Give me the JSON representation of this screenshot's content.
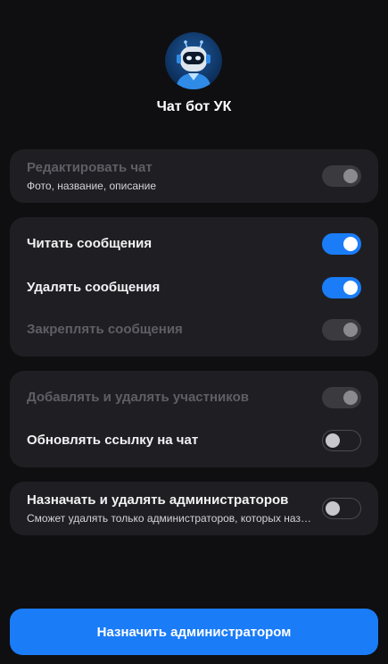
{
  "bot": {
    "name": "Чат бот УК",
    "avatar_icon": "robot-avatar-icon"
  },
  "groups": [
    {
      "items": [
        {
          "label": "Редактировать чат",
          "sublabel": "Фото, название, описание",
          "state": "disabled"
        }
      ]
    },
    {
      "items": [
        {
          "label": "Читать сообщения",
          "state": "on"
        },
        {
          "label": "Удалять сообщения",
          "state": "on"
        },
        {
          "label": "Закреплять сообщения",
          "state": "disabled"
        }
      ]
    },
    {
      "items": [
        {
          "label": "Добавлять и удалять участников",
          "state": "disabled"
        },
        {
          "label": "Обновлять ссылку на чат",
          "state": "off"
        }
      ]
    },
    {
      "items": [
        {
          "label": "Назначать и удалять администраторов",
          "sublabel": "Сможет удалять только администраторов, которых назначил",
          "state": "off"
        }
      ]
    }
  ],
  "action": {
    "label": "Назначить администратором"
  },
  "colors": {
    "accent": "#1a7cf7",
    "card": "#1f1f23",
    "background": "#0f0f11"
  }
}
